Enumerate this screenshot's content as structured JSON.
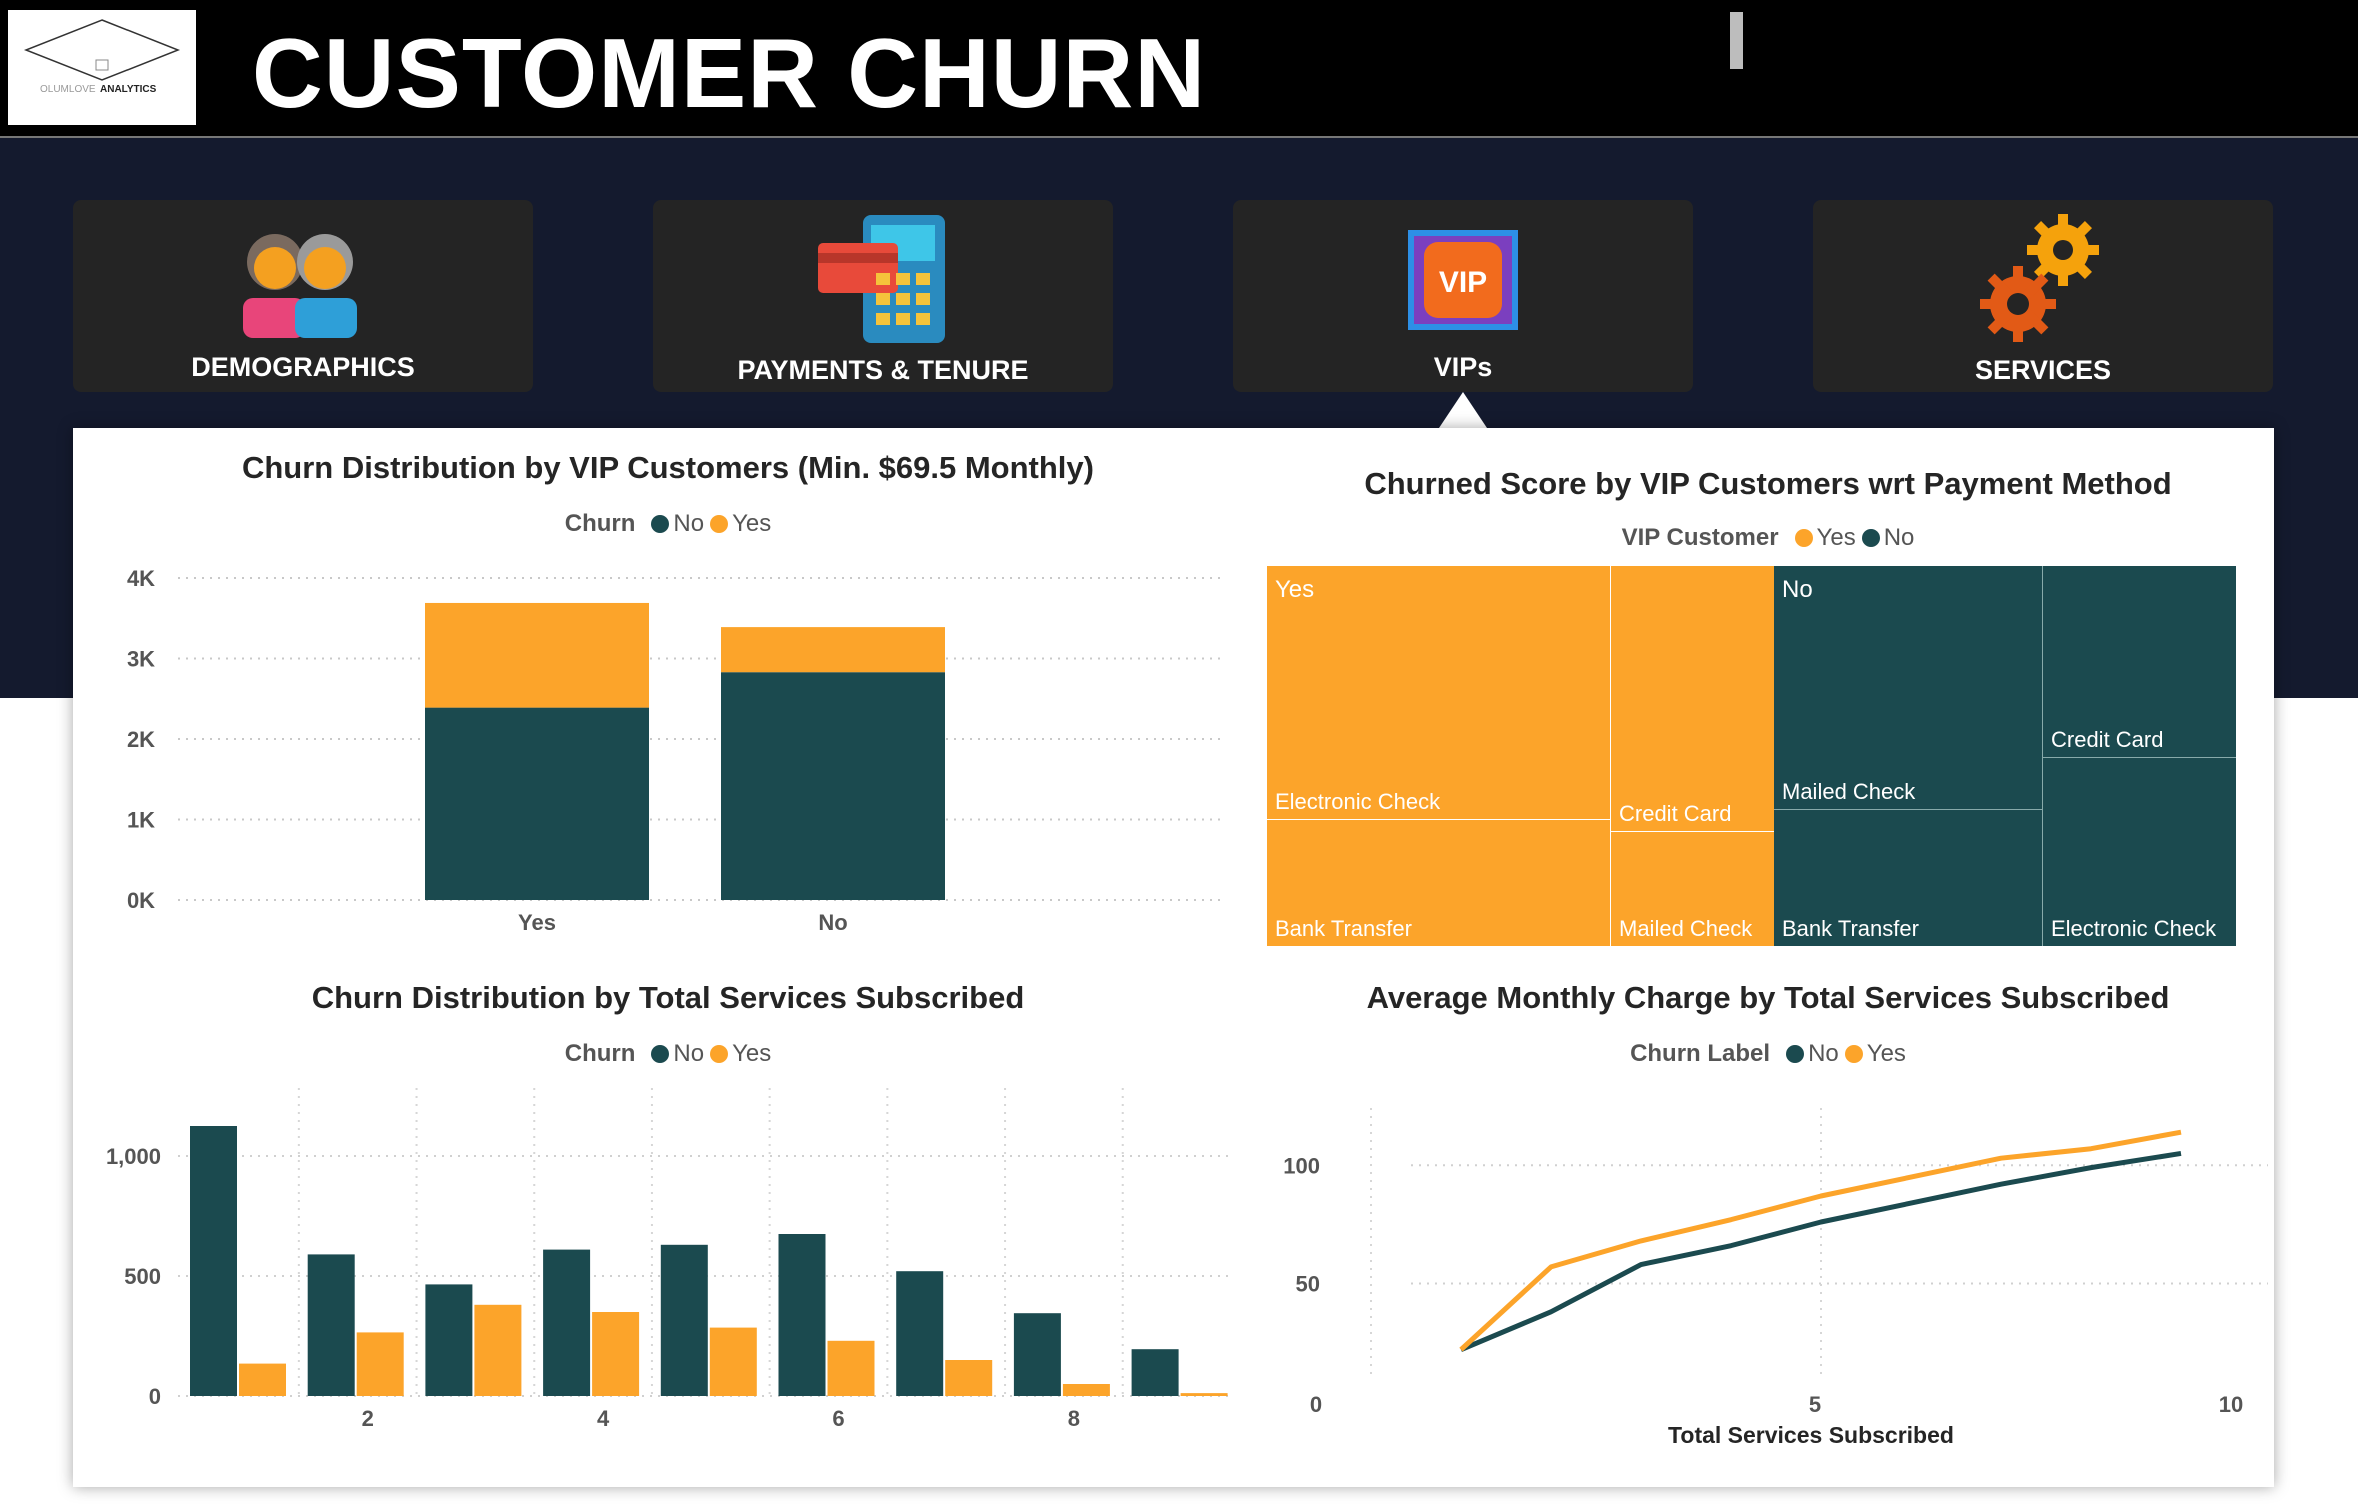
{
  "header": {
    "title": "CUSTOMER CHURN",
    "logo_text_1": "OLUMLOVE",
    "logo_text_2": "ANALYTICS"
  },
  "nav": [
    {
      "label": "DEMOGRAPHICS",
      "icon": "people-icon"
    },
    {
      "label": "PAYMENTS & TENURE",
      "icon": "payment-terminal-icon"
    },
    {
      "label": "VIPs",
      "icon": "vip-badge-icon",
      "active": true
    },
    {
      "label": "SERVICES",
      "icon": "gears-icon"
    }
  ],
  "colors": {
    "no": "#1b4a4f",
    "yes": "#fca42a",
    "nav_bg": "#242424",
    "band": "#141a2e"
  },
  "chart_data": [
    {
      "id": "vip_churn",
      "type": "bar",
      "stacked": true,
      "title": "Churn Distribution by VIP Customers (Min. $69.5 Monthly)",
      "legend_title": "Churn",
      "categories": [
        "Yes",
        "No"
      ],
      "series": [
        {
          "name": "No",
          "values": [
            2390,
            2830
          ]
        },
        {
          "name": "Yes",
          "values": [
            1300,
            560
          ]
        }
      ],
      "ylim": [
        0,
        4000
      ],
      "yticks": [
        "0K",
        "1K",
        "2K",
        "3K",
        "4K"
      ],
      "grid": true,
      "legend_position": "top"
    },
    {
      "id": "payment_treemap",
      "type": "treemap",
      "title": "Churned Score by VIP Customers wrt Payment Method",
      "legend_title": "VIP Customer",
      "legend": [
        "Yes",
        "No"
      ],
      "groups": [
        {
          "name": "Yes",
          "items": [
            {
              "label": "Electronic Check",
              "value": 1230
            },
            {
              "label": "Bank Transfer",
              "value": 720
            },
            {
              "label": "Credit Card",
              "value": 690
            },
            {
              "label": "Mailed Check",
              "value": 390
            }
          ]
        },
        {
          "name": "No",
          "items": [
            {
              "label": "Mailed Check",
              "value": 1110
            },
            {
              "label": "Bank Transfer",
              "value": 520
            },
            {
              "label": "Credit Card",
              "value": 500
            },
            {
              "label": "Electronic Check",
              "value": 490
            }
          ]
        }
      ]
    },
    {
      "id": "services_churn",
      "type": "bar",
      "title": "Churn Distribution by Total Services Subscribed",
      "legend_title": "Churn",
      "categories": [
        1,
        2,
        3,
        4,
        5,
        6,
        7,
        8,
        9
      ],
      "xticks": [
        "2",
        "4",
        "6",
        "8"
      ],
      "series": [
        {
          "name": "No",
          "values": [
            1125,
            590,
            465,
            610,
            630,
            675,
            520,
            345,
            195
          ]
        },
        {
          "name": "Yes",
          "values": [
            135,
            265,
            380,
            350,
            285,
            230,
            150,
            50,
            12
          ]
        }
      ],
      "ylim": [
        0,
        1200
      ],
      "yticks": [
        "0",
        "500",
        "1,000"
      ],
      "grid": true,
      "legend_position": "top"
    },
    {
      "id": "monthly_charge",
      "type": "line",
      "title": "Average Monthly Charge by Total Services Subscribed",
      "legend_title": "Churn Label",
      "xlabel": "Total Services Subscribed",
      "x": [
        1,
        2,
        3,
        4,
        5,
        6,
        7,
        8,
        9
      ],
      "series": [
        {
          "name": "No",
          "values": [
            22,
            38,
            58,
            66,
            76,
            84,
            92,
            99,
            105
          ]
        },
        {
          "name": "Yes",
          "values": [
            22,
            57,
            68,
            77,
            87,
            95,
            103,
            107,
            114
          ]
        }
      ],
      "xlim": [
        0,
        10
      ],
      "ylim": [
        10,
        120
      ],
      "xticks": [
        "0",
        "5",
        "10"
      ],
      "yticks": [
        "50",
        "100"
      ],
      "grid": true,
      "legend_position": "top"
    }
  ]
}
